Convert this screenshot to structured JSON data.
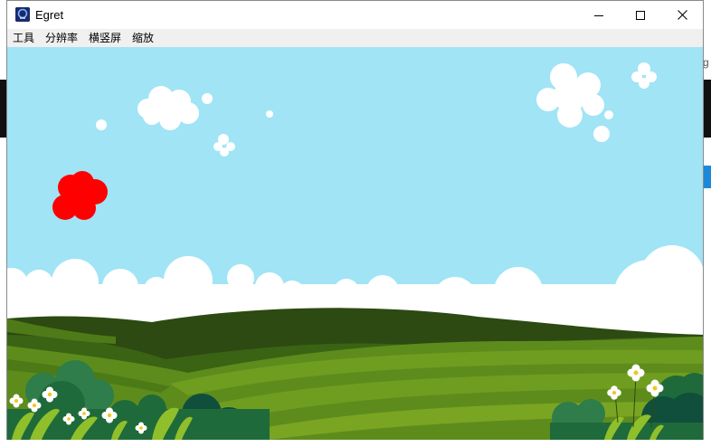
{
  "window": {
    "title": "Egret",
    "controls": {
      "minimize": "minimize",
      "maximize": "maximize",
      "close": "close"
    }
  },
  "menu": {
    "items": [
      {
        "id": "tools",
        "label": "工具"
      },
      {
        "id": "resolution",
        "label": "分辨率"
      },
      {
        "id": "orientation",
        "label": "横竖屏"
      },
      {
        "id": "zoom",
        "label": "缩放"
      }
    ]
  },
  "background_app": {
    "right_edge_letter": "g"
  },
  "scene": {
    "sky_color": "#a0e4f6",
    "cloud_color": "#ffffff",
    "red_sprite_color": "#ff0000",
    "hill_colors": [
      "#2c4a12",
      "#3a6314",
      "#5e8c1c",
      "#7aa523"
    ],
    "bush_colors": [
      "#1f6a3a",
      "#0f4f3c",
      "#2e7d4a"
    ],
    "flower_color": "#ffffff",
    "flower_center": "#f5c518"
  }
}
